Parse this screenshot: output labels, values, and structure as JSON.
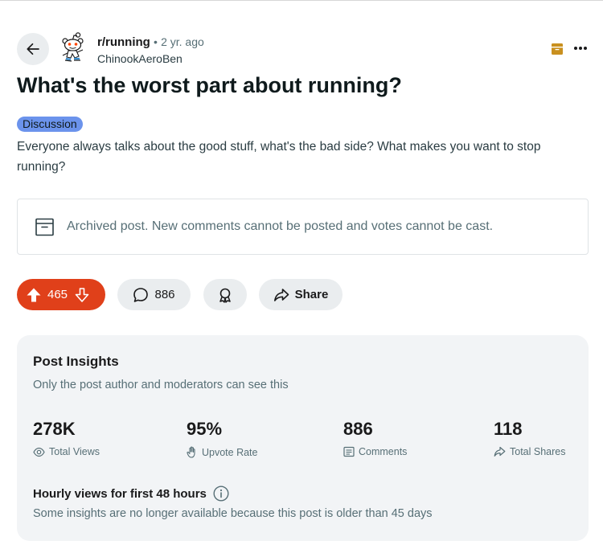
{
  "post": {
    "subreddit": "r/running",
    "separator": "•",
    "age": "2 yr. ago",
    "author": "ChinookAeroBen",
    "title": "What's the worst part about running?",
    "flair": "Discussion",
    "body": "Everyone always talks about the good stuff, what's the bad side? What makes you want to stop running?",
    "archived_notice": "Archived post. New comments cannot be posted and votes cannot be cast."
  },
  "actions": {
    "score": "465",
    "comments": "886",
    "share_label": "Share"
  },
  "insights": {
    "title": "Post Insights",
    "subtitle": "Only the post author and moderators can see this",
    "stats": [
      {
        "value": "278K",
        "label": "Total Views",
        "icon": "eye-icon"
      },
      {
        "value": "95%",
        "label": "Upvote Rate",
        "icon": "hand-wave-icon"
      },
      {
        "value": "886",
        "label": "Comments",
        "icon": "comments-doc-icon"
      },
      {
        "value": "118",
        "label": "Total Shares",
        "icon": "share-up-icon"
      }
    ],
    "hourly_title": "Hourly views for first 48 hours",
    "hourly_note": "Some insights are no longer available because this post is older than 45 days"
  },
  "colors": {
    "upvote_pill": "#e0401a",
    "flair": "#6b93ec",
    "archive_icon": "#c9901f",
    "pill_bg": "#eaedef",
    "insights_bg": "#f2f4f6"
  }
}
